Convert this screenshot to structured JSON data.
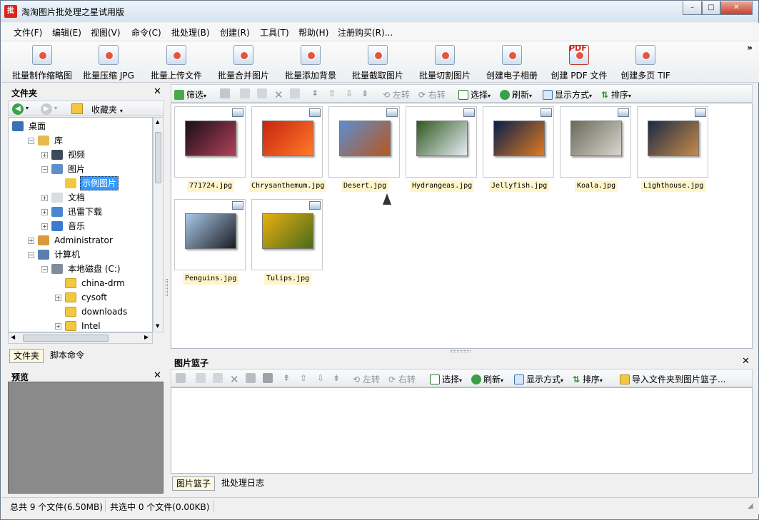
{
  "window": {
    "title": "淘淘图片批处理之星试用版",
    "app_icon_text": "批",
    "minimize_symbol": "–",
    "maximize_symbol": "□",
    "close_symbol": "✕"
  },
  "menu": [
    "文件(F)",
    "编辑(E)",
    "视图(V)",
    "命令(C)",
    "批处理(B)",
    "创建(R)",
    "工具(T)",
    "帮助(H)",
    "注册购买(R)..."
  ],
  "toolbar": {
    "buttons": [
      "批量制作缩略图",
      "批量压缩 JPG",
      "批量上传文件",
      "批量合并图片",
      "批量添加背景",
      "批量截取图片",
      "批量切割图片",
      "创建电子相册",
      "创建 PDF 文件",
      "创建多页 TIF"
    ],
    "overflow_symbol": "»",
    "pdf_badge": "PDF"
  },
  "folder_panel": {
    "title": "文件夹",
    "close_symbol": "✕",
    "favorites_label": "收藏夹",
    "tree": [
      {
        "label": "桌面",
        "level": 0,
        "expander": ""
      },
      {
        "label": "库",
        "level": 1,
        "expander": "−"
      },
      {
        "label": "视频",
        "level": 2,
        "expander": "+"
      },
      {
        "label": "图片",
        "level": 2,
        "expander": "−"
      },
      {
        "label": "示例图片",
        "level": 3,
        "expander": "",
        "selected": true
      },
      {
        "label": "文档",
        "level": 2,
        "expander": "+"
      },
      {
        "label": "迅雷下载",
        "level": 2,
        "expander": "+"
      },
      {
        "label": "音乐",
        "level": 2,
        "expander": "+"
      },
      {
        "label": "Administrator",
        "level": 1,
        "expander": "+"
      },
      {
        "label": "计算机",
        "level": 1,
        "expander": "−"
      },
      {
        "label": "本地磁盘 (C:)",
        "level": 2,
        "expander": "−"
      },
      {
        "label": "china-drm",
        "level": 3,
        "expander": ""
      },
      {
        "label": "cysoft",
        "level": 3,
        "expander": "+"
      },
      {
        "label": "downloads",
        "level": 3,
        "expander": ""
      },
      {
        "label": "Intel",
        "level": 3,
        "expander": "+"
      }
    ],
    "tabs": [
      "文件夹",
      "脚本命令"
    ]
  },
  "preview_panel": {
    "title": "预览",
    "close_symbol": "✕"
  },
  "main_toolbar": {
    "filter": "筛选",
    "rotate_left": "左转",
    "rotate_right": "右转",
    "select": "选择",
    "refresh": "刷新",
    "display_mode": "显示方式",
    "sort": "排序"
  },
  "gallery": {
    "items": [
      {
        "name": "771724.jpg",
        "colors": [
          "#1a0f18",
          "#b0405a"
        ]
      },
      {
        "name": "Chrysanthemum.jpg",
        "colors": [
          "#c8240e",
          "#ff7a2a"
        ]
      },
      {
        "name": "Desert.jpg",
        "colors": [
          "#5a8fd0",
          "#b8561e"
        ]
      },
      {
        "name": "Hydrangeas.jpg",
        "colors": [
          "#2f5a1e",
          "#e8ecf6"
        ]
      },
      {
        "name": "Jellyfish.jpg",
        "colors": [
          "#06204a",
          "#e07a22"
        ]
      },
      {
        "name": "Koala.jpg",
        "colors": [
          "#6b6a5a",
          "#d9d6cf"
        ]
      },
      {
        "name": "Lighthouse.jpg",
        "colors": [
          "#1c2a44",
          "#c88a4a"
        ]
      },
      {
        "name": "Penguins.jpg",
        "colors": [
          "#a8c8e8",
          "#1c1c22"
        ]
      },
      {
        "name": "Tulips.jpg",
        "colors": [
          "#e8b010",
          "#4a6a1a"
        ]
      }
    ]
  },
  "basket": {
    "title": "图片篮子",
    "close_symbol": "✕",
    "import_label": "导入文件夹到图片篮子...",
    "rotate_left": "左转",
    "rotate_right": "右转",
    "select": "选择",
    "refresh": "刷新",
    "display_mode": "显示方式",
    "sort": "排序",
    "tabs": [
      "图片篮子",
      "批处理日志"
    ]
  },
  "status": {
    "total": "总共 9 个文件(6.50MB)",
    "selected": "共选中 0 个文件(0.00KB)"
  },
  "colors": {
    "accent_blue": "#3b6fb6",
    "selected_bg": "#3399ff",
    "caption_bg": "#fff5cc",
    "tab_active_bg": "#fff8dc"
  }
}
